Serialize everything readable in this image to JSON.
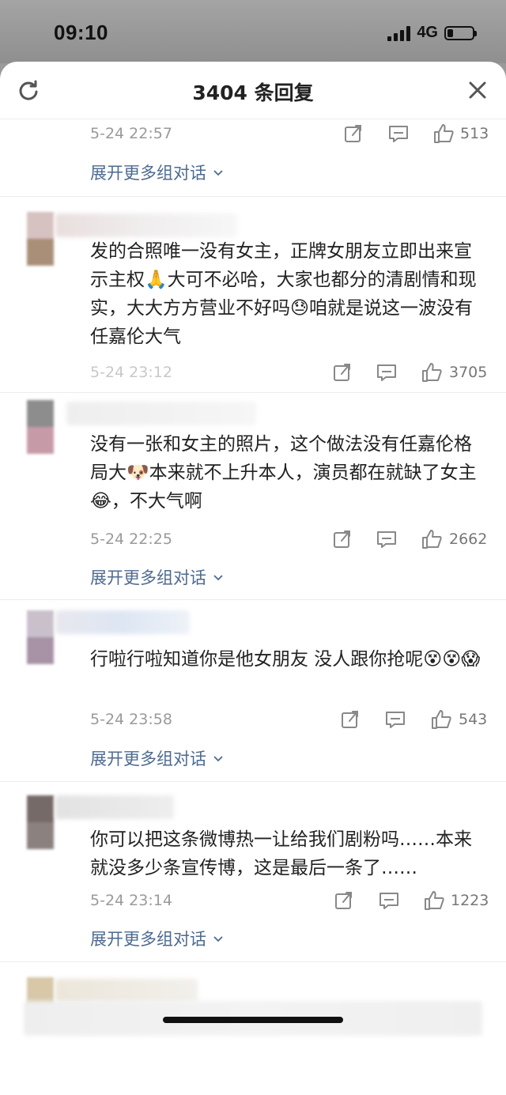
{
  "status_bar": {
    "time": "09:10",
    "network": "4G"
  },
  "header": {
    "title": "3404 条回复"
  },
  "top_row": {
    "time": "5-24 22:57",
    "likes": "513",
    "expand": "展开更多组对话"
  },
  "comments": [
    {
      "text": "发的合照唯一没有女主，正牌女朋友立即出来宣示主权🙏大可不必哈，大家也都分的清剧情和现实，大大方方营业不好吗😓咱就是说这一波没有任嘉伦大气",
      "time": "5-24 23:12",
      "likes": "3705",
      "expand": ""
    },
    {
      "text": "没有一张和女主的照片，这个做法没有任嘉伦格局大🐶本来就不上升本人，演员都在就缺了女主😂，不大气啊",
      "time": "5-24 22:25",
      "likes": "2662",
      "expand": "展开更多组对话"
    },
    {
      "text": "行啦行啦知道你是他女朋友 没人跟你抢呢😵😵😱",
      "time": "5-24 23:58",
      "likes": "543",
      "expand": "展开更多组对话"
    },
    {
      "text": "你可以把这条微博热一让给我们剧粉吗……本来就没多少条宣传博，这是最后一条了……",
      "time": "5-24 23:14",
      "likes": "1223",
      "expand": "展开更多组对话"
    }
  ],
  "icons": {
    "refresh": "refresh-icon",
    "close": "close-icon",
    "share": "share-icon",
    "comment": "comment-icon",
    "like": "thumbs-up-icon",
    "expand": "chevron-down-icon"
  },
  "colors": {
    "link": "#4d6a8f",
    "meta": "#9a9a9a",
    "text": "#222222"
  }
}
